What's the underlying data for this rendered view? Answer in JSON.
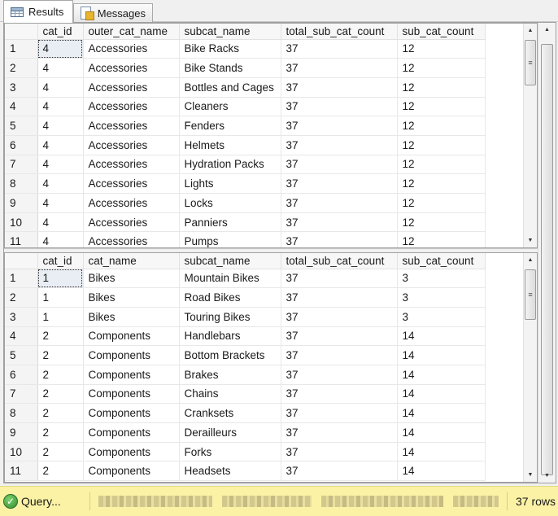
{
  "tabs": [
    {
      "label": "Results",
      "icon": "grid-icon",
      "active": true
    },
    {
      "label": "Messages",
      "icon": "messages-icon",
      "active": false
    }
  ],
  "grid1": {
    "columns": [
      "",
      "cat_id",
      "outer_cat_name",
      "subcat_name",
      "total_sub_cat_count",
      "sub_cat_count"
    ],
    "rows": [
      [
        "1",
        "4",
        "Accessories",
        "Bike Racks",
        "37",
        "12"
      ],
      [
        "2",
        "4",
        "Accessories",
        "Bike Stands",
        "37",
        "12"
      ],
      [
        "3",
        "4",
        "Accessories",
        "Bottles and Cages",
        "37",
        "12"
      ],
      [
        "4",
        "4",
        "Accessories",
        "Cleaners",
        "37",
        "12"
      ],
      [
        "5",
        "4",
        "Accessories",
        "Fenders",
        "37",
        "12"
      ],
      [
        "6",
        "4",
        "Accessories",
        "Helmets",
        "37",
        "12"
      ],
      [
        "7",
        "4",
        "Accessories",
        "Hydration Packs",
        "37",
        "12"
      ],
      [
        "8",
        "4",
        "Accessories",
        "Lights",
        "37",
        "12"
      ],
      [
        "9",
        "4",
        "Accessories",
        "Locks",
        "37",
        "12"
      ],
      [
        "10",
        "4",
        "Accessories",
        "Panniers",
        "37",
        "12"
      ],
      [
        "11",
        "4",
        "Accessories",
        "Pumps",
        "37",
        "12"
      ]
    ]
  },
  "grid2": {
    "columns": [
      "",
      "cat_id",
      "cat_name",
      "subcat_name",
      "total_sub_cat_count",
      "sub_cat_count"
    ],
    "rows": [
      [
        "1",
        "1",
        "Bikes",
        "Mountain Bikes",
        "37",
        "3"
      ],
      [
        "2",
        "1",
        "Bikes",
        "Road Bikes",
        "37",
        "3"
      ],
      [
        "3",
        "1",
        "Bikes",
        "Touring Bikes",
        "37",
        "3"
      ],
      [
        "4",
        "2",
        "Components",
        "Handlebars",
        "37",
        "14"
      ],
      [
        "5",
        "2",
        "Components",
        "Bottom Brackets",
        "37",
        "14"
      ],
      [
        "6",
        "2",
        "Components",
        "Brakes",
        "37",
        "14"
      ],
      [
        "7",
        "2",
        "Components",
        "Chains",
        "37",
        "14"
      ],
      [
        "8",
        "2",
        "Components",
        "Cranksets",
        "37",
        "14"
      ],
      [
        "9",
        "2",
        "Components",
        "Derailleurs",
        "37",
        "14"
      ],
      [
        "10",
        "2",
        "Components",
        "Forks",
        "37",
        "14"
      ],
      [
        "11",
        "2",
        "Components",
        "Headsets",
        "37",
        "14"
      ]
    ]
  },
  "scrollbar_glyphs": {
    "up": "▲",
    "down": "▼",
    "grip": "≡"
  },
  "status": {
    "icon": "check-icon",
    "icon_glyph": "✓",
    "text": "Query...",
    "rows": "37 rows"
  }
}
